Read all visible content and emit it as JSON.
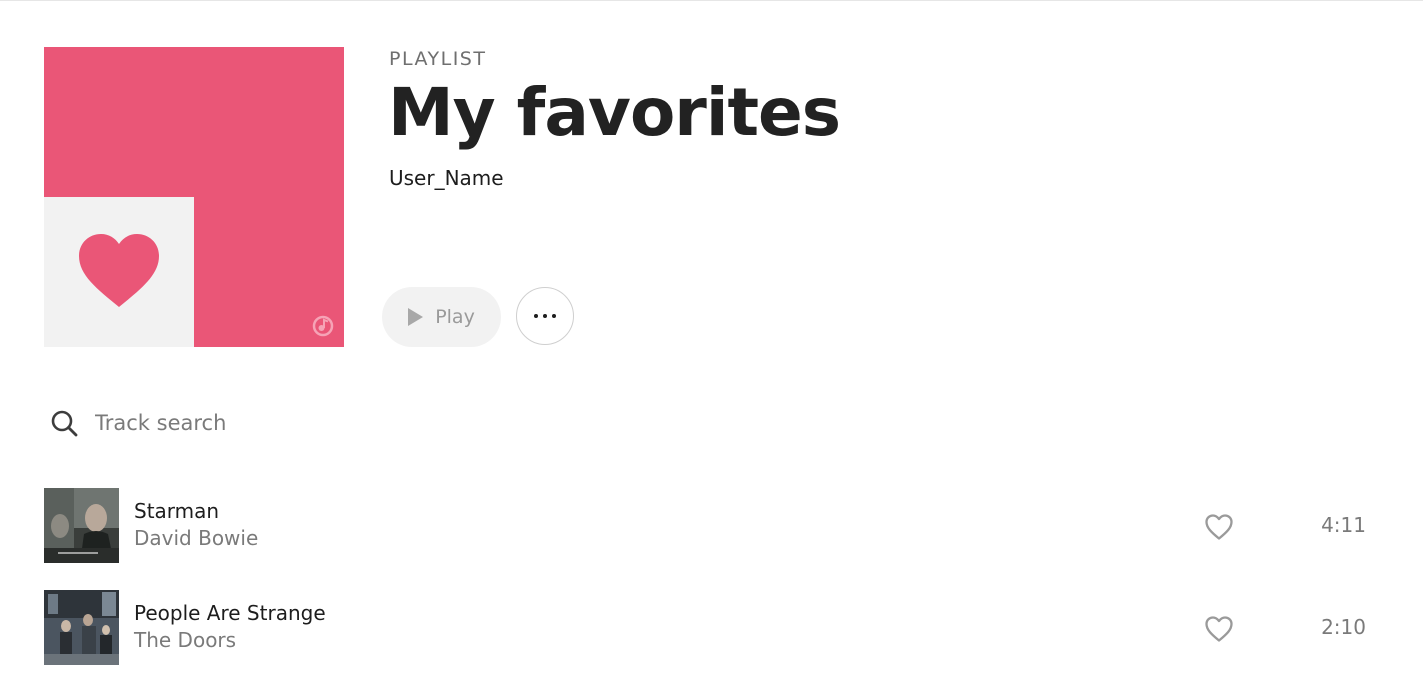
{
  "colors": {
    "accent": "#ea5677",
    "cover_inner": "#f2f2f2",
    "text_primary": "#1d1d1d",
    "text_secondary": "#7a7a7a"
  },
  "playlist": {
    "kicker": "PLAYLIST",
    "title": "My favorites",
    "owner": "User_Name",
    "cover_icon": "heart-icon",
    "cover_logo_icon": "music-note-logo-icon"
  },
  "actions": {
    "play_label": "Play",
    "play_icon": "play-icon",
    "more_icon": "more-dots-icon"
  },
  "search": {
    "placeholder": "Track search",
    "value": "",
    "icon": "search-icon"
  },
  "tracks": [
    {
      "title": "Starman",
      "artist": "David Bowie",
      "duration": "4:11",
      "liked": false
    },
    {
      "title": "People Are Strange",
      "artist": "The Doors",
      "duration": "2:10",
      "liked": false
    }
  ]
}
